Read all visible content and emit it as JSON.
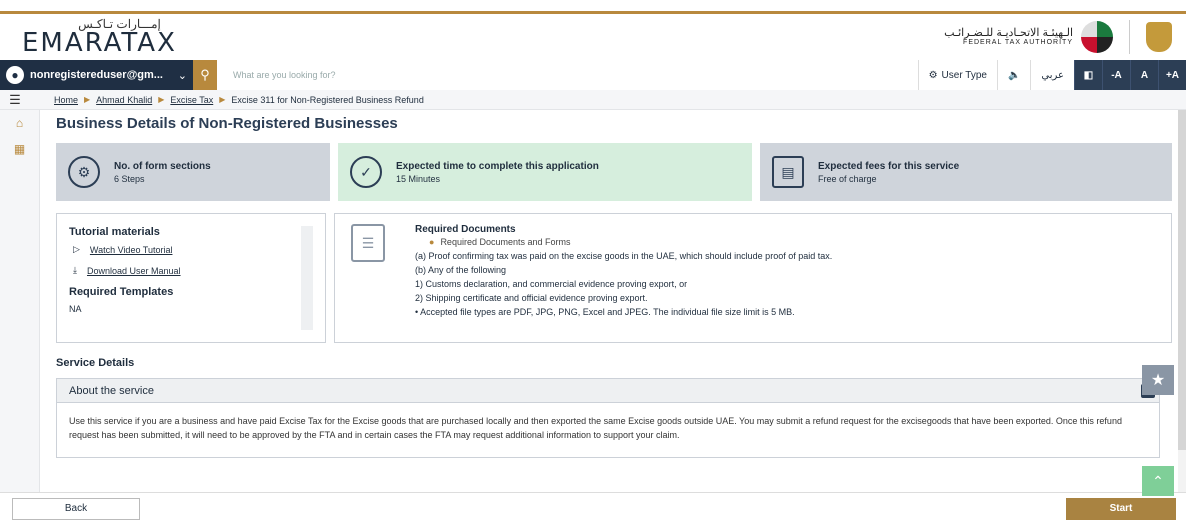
{
  "brand": {
    "logo_ar": "إمـــارات تـاكـس",
    "logo_en": "EMARATAX",
    "fta_ar": "الـهيئـة الاتحـاديـة للـضـرائـب",
    "fta_en": "FEDERAL TAX AUTHORITY"
  },
  "navbar": {
    "user": "nonregistereduser@gm...",
    "search_placeholder": "What are you looking for?",
    "user_type": "User Type",
    "arabic": "عربي",
    "font_minus": "-A",
    "font_normal": "A",
    "font_plus": "+A"
  },
  "breadcrumb": {
    "home": "Home",
    "person": "Ahmad Khalid",
    "section": "Excise Tax",
    "current": "Excise 311 for Non-Registered Business Refund"
  },
  "page": {
    "title": "Business Details of Non-Registered Businesses"
  },
  "info": {
    "sections_label": "No. of form sections",
    "sections_value": "6 Steps",
    "time_label": "Expected time to complete this application",
    "time_value": "15 Minutes",
    "fees_label": "Expected fees for this service",
    "fees_value": "Free of charge"
  },
  "tutorial": {
    "heading": "Tutorial materials",
    "video": "Watch Video Tutorial",
    "manual": "Download User Manual",
    "templates_heading": "Required Templates",
    "templates_value": "NA"
  },
  "documents": {
    "heading": "Required Documents",
    "bullet": "Required Documents and Forms",
    "lines": [
      "(a) Proof confirming tax was paid on the excise goods in the UAE, which should include proof of paid tax.",
      "(b) Any of the following",
      "1) Customs declaration, and commercial evidence proving export, or",
      "2) Shipping certificate and official evidence proving export.",
      "• Accepted file types are PDF, JPG, PNG, Excel and JPEG. The individual file size limit is 5 MB."
    ]
  },
  "service": {
    "title": "Service Details",
    "about_heading": "About the service",
    "about_text": "Use this service if you are a business and have paid Excise Tax for the Excise goods that are purchased locally and then exported the same Excise goods outside UAE. You may submit a refund request for the excisegoods that have been exported. Once this refund request has been submitted, it will need to be approved by the FTA and in certain cases the FTA may request additional information to support your claim."
  },
  "footer": {
    "back": "Back",
    "start": "Start"
  }
}
